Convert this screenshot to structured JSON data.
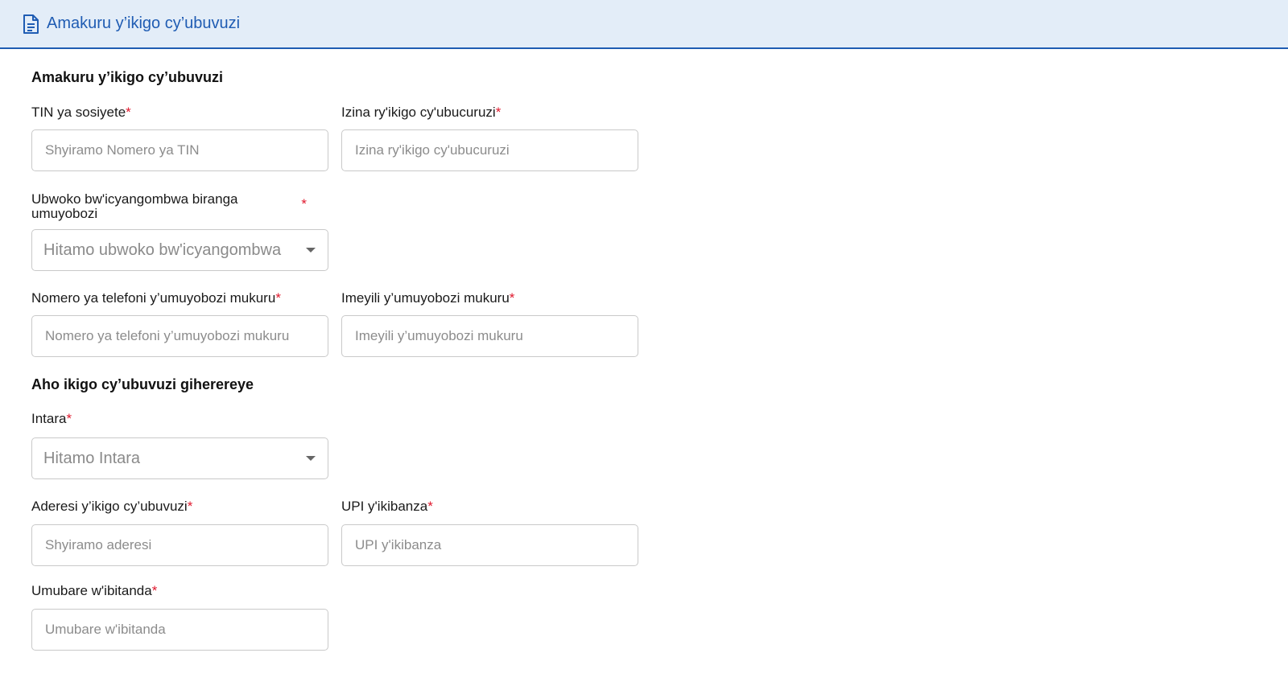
{
  "header": {
    "title": "Amakuru y’ikigo cy’ubuvuzi",
    "icon": "document-icon",
    "accent": "#1f5cb3",
    "background": "#e3edf8"
  },
  "form": {
    "section1_title": "Amakuru y’ikigo cy’ubuvuzi",
    "tin": {
      "label": "TIN ya sosiyete",
      "placeholder": "Shyiramo Nomero ya TIN"
    },
    "business_name": {
      "label": "Izina ry'ikigo cy'ubucuruzi",
      "placeholder": "Izina ry'ikigo cy'ubucuruzi"
    },
    "doc_type": {
      "label": "Ubwoko bw'icyangombwa biranga umuyobozi",
      "selected": "Hitamo ubwoko bw'icyangombwa"
    },
    "phone": {
      "label": "Nomero ya telefoni y’umuyobozi mukuru",
      "placeholder": "Nomero ya telefoni y’umuyobozi mukuru"
    },
    "email": {
      "label": "Imeyili y’umuyobozi mukuru",
      "placeholder": "Imeyili y’umuyobozi mukuru"
    },
    "section2_title": "Aho ikigo cy’ubuvuzi giherereye",
    "province": {
      "label": "Intara",
      "selected": "Hitamo Intara"
    },
    "address": {
      "label": "Aderesi y’ikigo cy’ubuvuzi",
      "placeholder": "Shyiramo aderesi"
    },
    "upi": {
      "label": "UPI y'ikibanza",
      "placeholder": "UPI y'ikibanza"
    },
    "beds": {
      "label": "Umubare w'ibitanda",
      "placeholder": "Umubare w'ibitanda"
    },
    "required_marker": "*",
    "required_color": "#e0182d"
  }
}
